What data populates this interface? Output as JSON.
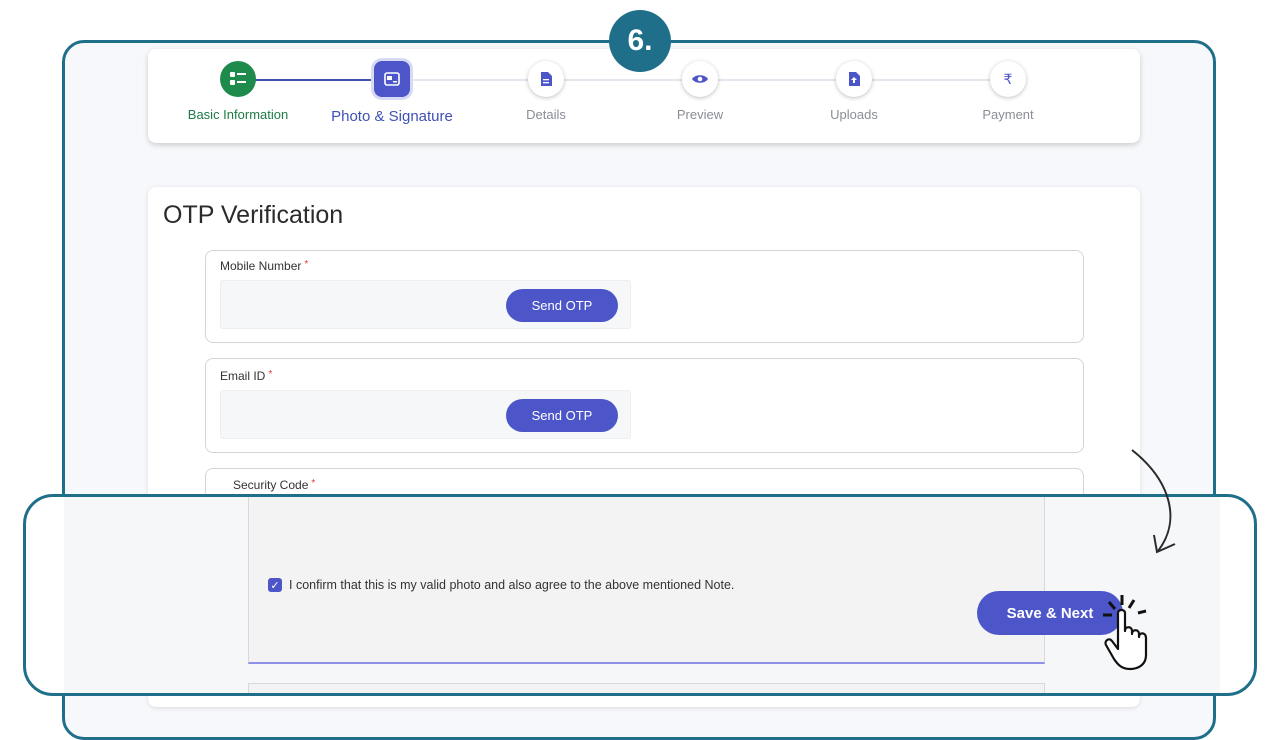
{
  "step_badge": "6.",
  "stepper": {
    "steps": [
      {
        "label": "Basic Information",
        "icon": "list-icon",
        "state": "done"
      },
      {
        "label": "Photo & Signature",
        "icon": "photo-icon",
        "state": "active"
      },
      {
        "label": "Details",
        "icon": "document-icon",
        "state": "pending"
      },
      {
        "label": "Preview",
        "icon": "eye-icon",
        "state": "pending"
      },
      {
        "label": "Uploads",
        "icon": "upload-file-icon",
        "state": "pending"
      },
      {
        "label": "Payment",
        "icon": "rupee-icon",
        "state": "pending",
        "glyph": "₹"
      }
    ]
  },
  "main": {
    "title": "OTP Verification",
    "mobile": {
      "label": "Mobile Number",
      "required": "*",
      "value": "",
      "button": "Send OTP"
    },
    "email": {
      "label": "Email ID",
      "required": "*",
      "value": "",
      "button": "Send OTP"
    },
    "security": {
      "label": "Security Code",
      "required": "*"
    }
  },
  "zoom": {
    "confirm_checked": true,
    "confirm_text": "I confirm that this is my valid photo and also agree to the above mentioned Note.",
    "save_button": "Save & Next"
  },
  "colors": {
    "frame": "#1f6f8b",
    "primary": "#4d56c9",
    "done": "#1e8a4c"
  }
}
